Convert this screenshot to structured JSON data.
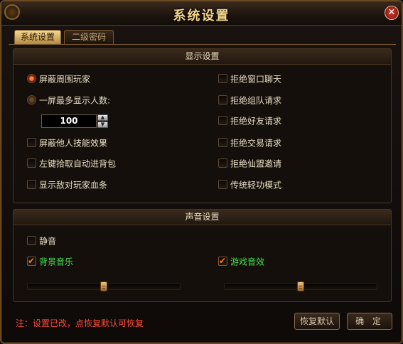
{
  "window": {
    "title": "系统设置",
    "close_glyph": "✕"
  },
  "tabs": [
    {
      "label": "系统设置",
      "active": true
    },
    {
      "label": "二级密码",
      "active": false
    }
  ],
  "display": {
    "heading": "显示设置",
    "left": {
      "shield_players": {
        "label": "屏蔽周围玩家",
        "selected": true
      },
      "max_players": {
        "label": "一屏最多显示人数:",
        "selected": false,
        "value": "100"
      },
      "hide_skill_effects": {
        "label": "屏蔽他人技能效果",
        "checked": false
      },
      "left_click_pickup": {
        "label": "左键拾取自动进背包",
        "checked": false
      },
      "show_enemy_hp": {
        "label": "显示敌对玩家血条",
        "checked": false
      }
    },
    "right": {
      "refuse_private_chat": {
        "label": "拒绝窗口聊天",
        "checked": false
      },
      "refuse_team": {
        "label": "拒绝组队请求",
        "checked": false
      },
      "refuse_friend": {
        "label": "拒绝好友请求",
        "checked": false
      },
      "refuse_trade": {
        "label": "拒绝交易请求",
        "checked": false
      },
      "refuse_alliance": {
        "label": "拒绝仙盟邀请",
        "checked": false
      },
      "classic_qinggong": {
        "label": "传统轻功模式",
        "checked": false
      }
    }
  },
  "sound": {
    "heading": "声音设置",
    "mute": {
      "label": "静音",
      "checked": false
    },
    "bgm": {
      "label": "背景音乐",
      "checked": true,
      "volume": 0.5
    },
    "sfx": {
      "label": "游戏音效",
      "checked": true,
      "volume": 0.5
    }
  },
  "footer": {
    "note": "注：设置已改，点恢复默认可恢复",
    "restore_label": "恢复默认",
    "ok_label": "确 定"
  },
  "colors": {
    "accent": "#f2d58a",
    "note": "#ff4a3a",
    "enabled_label": "#41e14a",
    "check": "#ff7a1a"
  }
}
